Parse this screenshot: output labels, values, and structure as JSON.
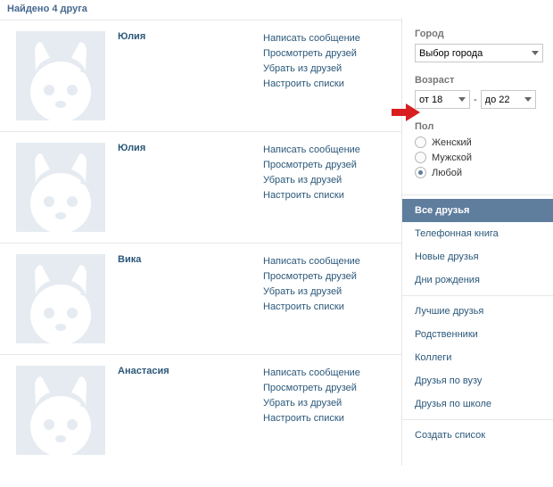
{
  "header": {
    "count_text": "Найдено 4 друга"
  },
  "friends": [
    {
      "name": "Юлия"
    },
    {
      "name": "Юлия"
    },
    {
      "name": "Вика"
    },
    {
      "name": "Анастасия"
    }
  ],
  "actions": {
    "write": "Написать сообщение",
    "view_friends": "Просмотреть друзей",
    "remove": "Убрать из друзей",
    "configure_lists": "Настроить списки"
  },
  "filters": {
    "city_label": "Город",
    "city_value": "Выбор города",
    "age_label": "Возраст",
    "age_from": "от 18",
    "age_to": "до 22",
    "age_sep": "-",
    "gender_label": "Пол",
    "gender_female": "Женский",
    "gender_male": "Мужской",
    "gender_any": "Любой"
  },
  "lists": {
    "all": "Все друзья",
    "phonebook": "Телефонная книга",
    "new": "Новые друзья",
    "birthdays": "Дни рождения",
    "best": "Лучшие друзья",
    "relatives": "Родственники",
    "colleagues": "Коллеги",
    "uni": "Друзья по вузу",
    "school": "Друзья по школе",
    "create": "Создать список"
  }
}
